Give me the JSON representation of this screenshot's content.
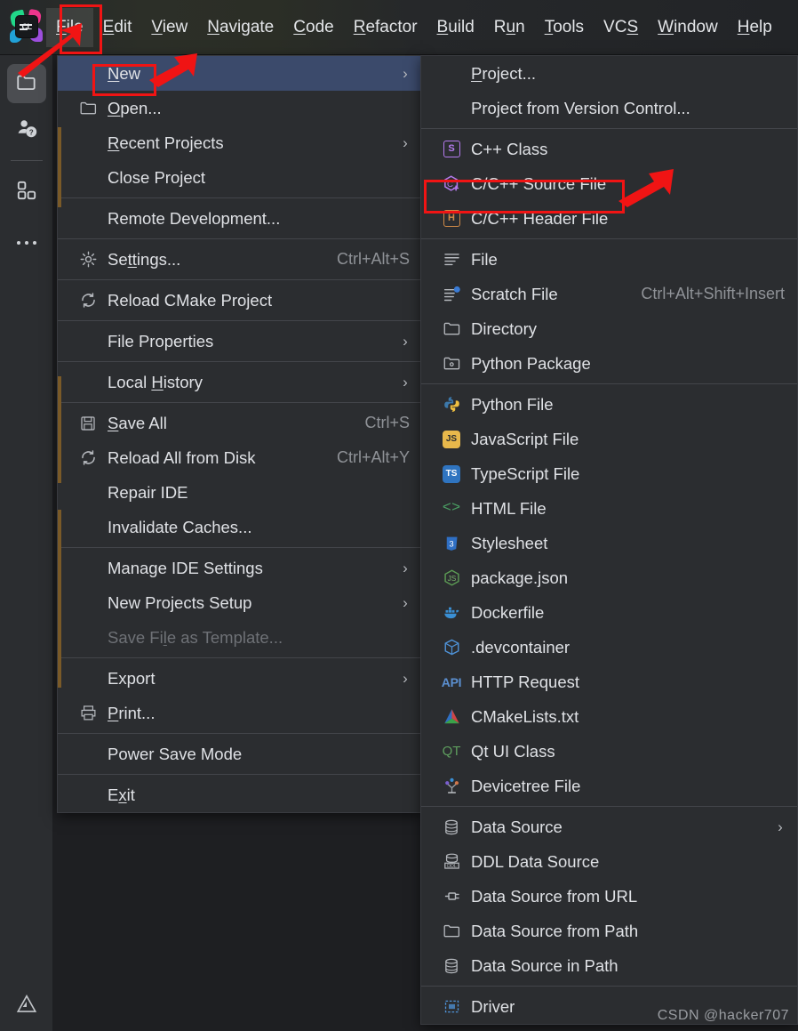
{
  "app": {
    "name": "CLion",
    "logo_text": "CL"
  },
  "menubar": {
    "items": [
      {
        "label": "File",
        "mnemonic": "F",
        "active": true
      },
      {
        "label": "Edit",
        "mnemonic": "E",
        "active": false
      },
      {
        "label": "View",
        "mnemonic": "V",
        "active": false
      },
      {
        "label": "Navigate",
        "mnemonic": "N",
        "active": false
      },
      {
        "label": "Code",
        "mnemonic": "C",
        "active": false
      },
      {
        "label": "Refactor",
        "mnemonic": "R",
        "active": false
      },
      {
        "label": "Build",
        "mnemonic": "B",
        "active": false
      },
      {
        "label": "Run",
        "mnemonic": "u",
        "active": false
      },
      {
        "label": "Tools",
        "mnemonic": "T",
        "active": false
      },
      {
        "label": "VCS",
        "mnemonic": "S",
        "active": false
      },
      {
        "label": "Window",
        "mnemonic": "W",
        "active": false
      },
      {
        "label": "Help",
        "mnemonic": "H",
        "active": false
      }
    ]
  },
  "rail": {
    "items": [
      {
        "icon": "project-folder-icon",
        "selected": true
      },
      {
        "icon": "learn-help-icon",
        "selected": false
      },
      {
        "icon": "plugins-grid-icon",
        "selected": false
      },
      {
        "icon": "more-ellipsis-icon",
        "selected": false
      }
    ],
    "status_icon": "warning-triangle-icon"
  },
  "file_menu": {
    "items": [
      {
        "label": "New",
        "mnemonic": "N",
        "icon": "",
        "shortcut": "",
        "submenu": true,
        "selected": true,
        "disabled": false
      },
      {
        "label": "Open...",
        "mnemonic": "O",
        "icon": "folder-icon",
        "shortcut": "",
        "submenu": false,
        "selected": false,
        "disabled": false
      },
      {
        "label": "Recent Projects",
        "mnemonic": "R",
        "icon": "",
        "shortcut": "",
        "submenu": true,
        "selected": false,
        "disabled": false
      },
      {
        "label": "Close Project",
        "mnemonic": "",
        "icon": "",
        "shortcut": "",
        "submenu": false,
        "selected": false,
        "disabled": false
      },
      {
        "separator": true
      },
      {
        "label": "Remote Development...",
        "mnemonic": "",
        "icon": "",
        "shortcut": "",
        "submenu": false,
        "selected": false,
        "disabled": false
      },
      {
        "separator": true
      },
      {
        "label": "Settings...",
        "mnemonic": "tt",
        "icon": "gear-icon",
        "shortcut": "Ctrl+Alt+S",
        "submenu": false,
        "selected": false,
        "disabled": false
      },
      {
        "separator": true
      },
      {
        "label": "Reload CMake Project",
        "mnemonic": "",
        "icon": "refresh-icon",
        "shortcut": "",
        "submenu": false,
        "selected": false,
        "disabled": false
      },
      {
        "separator": true
      },
      {
        "label": "File Properties",
        "mnemonic": "",
        "icon": "",
        "shortcut": "",
        "submenu": true,
        "selected": false,
        "disabled": false
      },
      {
        "separator": true
      },
      {
        "label": "Local History",
        "mnemonic": "H",
        "icon": "",
        "shortcut": "",
        "submenu": true,
        "selected": false,
        "disabled": false
      },
      {
        "separator": true
      },
      {
        "label": "Save All",
        "mnemonic": "S",
        "icon": "save-disk-icon",
        "shortcut": "Ctrl+S",
        "submenu": false,
        "selected": false,
        "disabled": false
      },
      {
        "label": "Reload All from Disk",
        "mnemonic": "",
        "icon": "refresh-icon",
        "shortcut": "Ctrl+Alt+Y",
        "submenu": false,
        "selected": false,
        "disabled": false
      },
      {
        "label": "Repair IDE",
        "mnemonic": "",
        "icon": "",
        "shortcut": "",
        "submenu": false,
        "selected": false,
        "disabled": false
      },
      {
        "label": "Invalidate Caches...",
        "mnemonic": "",
        "icon": "",
        "shortcut": "",
        "submenu": false,
        "selected": false,
        "disabled": false
      },
      {
        "separator": true
      },
      {
        "label": "Manage IDE Settings",
        "mnemonic": "",
        "icon": "",
        "shortcut": "",
        "submenu": true,
        "selected": false,
        "disabled": false
      },
      {
        "label": "New Projects Setup",
        "mnemonic": "",
        "icon": "",
        "shortcut": "",
        "submenu": true,
        "selected": false,
        "disabled": false
      },
      {
        "label": "Save File as Template...",
        "mnemonic": "l",
        "icon": "",
        "shortcut": "",
        "submenu": false,
        "selected": false,
        "disabled": true
      },
      {
        "separator": true
      },
      {
        "label": "Export",
        "mnemonic": "",
        "icon": "",
        "shortcut": "",
        "submenu": true,
        "selected": false,
        "disabled": false
      },
      {
        "label": "Print...",
        "mnemonic": "P",
        "icon": "printer-icon",
        "shortcut": "",
        "submenu": false,
        "selected": false,
        "disabled": false
      },
      {
        "separator": true
      },
      {
        "label": "Power Save Mode",
        "mnemonic": "",
        "icon": "",
        "shortcut": "",
        "submenu": false,
        "selected": false,
        "disabled": false
      },
      {
        "separator": true
      },
      {
        "label": "Exit",
        "mnemonic": "x",
        "icon": "",
        "shortcut": "",
        "submenu": false,
        "selected": false,
        "disabled": false
      }
    ]
  },
  "new_submenu": {
    "items": [
      {
        "label": "Project...",
        "mnemonic": "P",
        "icon": "",
        "shortcut": "",
        "submenu": false
      },
      {
        "label": "Project from Version Control...",
        "mnemonic": "",
        "icon": "",
        "shortcut": "",
        "submenu": false
      },
      {
        "separator": true
      },
      {
        "label": "C++ Class",
        "mnemonic": "",
        "icon": "cpp-class-icon",
        "shortcut": "",
        "submenu": false
      },
      {
        "label": "C/C++ Source File",
        "mnemonic": "",
        "icon": "cpp-source-icon",
        "shortcut": "",
        "submenu": false,
        "highlighted": true
      },
      {
        "label": "C/C++ Header File",
        "mnemonic": "",
        "icon": "cpp-header-icon",
        "shortcut": "",
        "submenu": false
      },
      {
        "separator": true
      },
      {
        "label": "File",
        "mnemonic": "",
        "icon": "file-lines-icon",
        "shortcut": "",
        "submenu": false
      },
      {
        "label": "Scratch File",
        "mnemonic": "",
        "icon": "scratch-file-icon",
        "shortcut": "Ctrl+Alt+Shift+Insert",
        "submenu": false
      },
      {
        "label": "Directory",
        "mnemonic": "",
        "icon": "directory-icon",
        "shortcut": "",
        "submenu": false
      },
      {
        "label": "Python Package",
        "mnemonic": "",
        "icon": "python-package-icon",
        "shortcut": "",
        "submenu": false
      },
      {
        "separator": true
      },
      {
        "label": "Python File",
        "mnemonic": "",
        "icon": "python-file-icon",
        "shortcut": "",
        "submenu": false
      },
      {
        "label": "JavaScript File",
        "mnemonic": "",
        "icon": "javascript-file-icon",
        "shortcut": "",
        "submenu": false
      },
      {
        "label": "TypeScript File",
        "mnemonic": "",
        "icon": "typescript-file-icon",
        "shortcut": "",
        "submenu": false
      },
      {
        "label": "HTML File",
        "mnemonic": "",
        "icon": "html-file-icon",
        "shortcut": "",
        "submenu": false
      },
      {
        "label": "Stylesheet",
        "mnemonic": "",
        "icon": "stylesheet-icon",
        "shortcut": "",
        "submenu": false
      },
      {
        "label": "package.json",
        "mnemonic": "",
        "icon": "nodejs-package-json-icon",
        "shortcut": "",
        "submenu": false
      },
      {
        "label": "Dockerfile",
        "mnemonic": "",
        "icon": "docker-icon",
        "shortcut": "",
        "submenu": false
      },
      {
        "label": ".devcontainer",
        "mnemonic": "",
        "icon": "devcontainer-cube-icon",
        "shortcut": "",
        "submenu": false
      },
      {
        "label": "HTTP Request",
        "mnemonic": "",
        "icon": "http-request-api-icon",
        "shortcut": "",
        "submenu": false
      },
      {
        "label": "CMakeLists.txt",
        "mnemonic": "",
        "icon": "cmake-icon",
        "shortcut": "",
        "submenu": false
      },
      {
        "label": "Qt UI Class",
        "mnemonic": "",
        "icon": "qt-icon",
        "shortcut": "",
        "submenu": false
      },
      {
        "label": "Devicetree File",
        "mnemonic": "",
        "icon": "devicetree-icon",
        "shortcut": "",
        "submenu": false
      },
      {
        "separator": true
      },
      {
        "label": "Data Source",
        "mnemonic": "",
        "icon": "database-icon",
        "shortcut": "",
        "submenu": true
      },
      {
        "label": "DDL Data Source",
        "mnemonic": "",
        "icon": "ddl-data-source-icon",
        "shortcut": "",
        "submenu": false
      },
      {
        "label": "Data Source from URL",
        "mnemonic": "",
        "icon": "plug-icon",
        "shortcut": "",
        "submenu": false
      },
      {
        "label": "Data Source from Path",
        "mnemonic": "",
        "icon": "folder-icon",
        "shortcut": "",
        "submenu": false
      },
      {
        "label": "Data Source in Path",
        "mnemonic": "",
        "icon": "database-icon",
        "shortcut": "",
        "submenu": false
      },
      {
        "separator": true
      },
      {
        "label": "Driver",
        "mnemonic": "",
        "icon": "driver-icon",
        "shortcut": "",
        "submenu": false
      }
    ]
  },
  "annotations": {
    "highlight_color": "#f01414",
    "boxes": [
      "file-menubar-item",
      "new-menu-item",
      "c-cpp-source-file-item"
    ],
    "arrows": [
      "arrow-to-file-menu",
      "arrow-to-new-item",
      "arrow-to-source-file-item"
    ]
  },
  "watermark": {
    "text": "CSDN @hacker707"
  }
}
